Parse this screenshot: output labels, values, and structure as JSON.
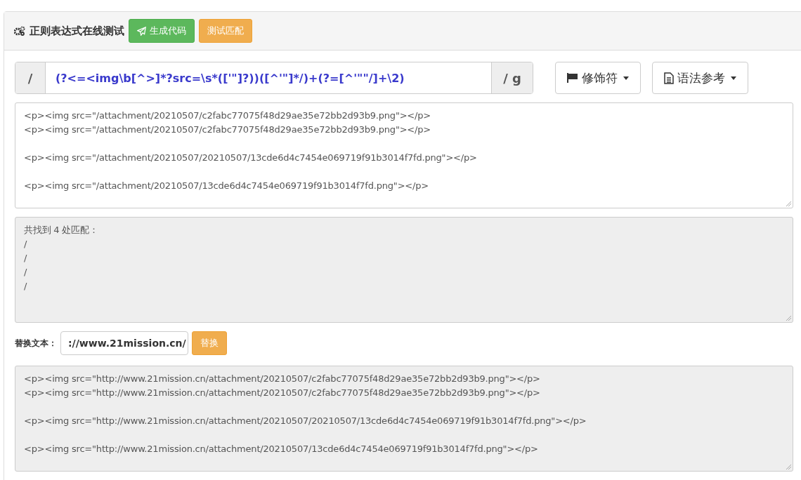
{
  "panel": {
    "title": "正则表达式在线测试",
    "buttons": [
      {
        "label": "生成代码",
        "kind": "success"
      },
      {
        "label": "测试匹配",
        "kind": "warning"
      }
    ]
  },
  "regex": {
    "prefix": "/",
    "value": "(?<=<img\\b[^>]*?src=\\s*(['\"]?))([^'\"]*/)+(?=[^'\"\"/]+\\2)",
    "suffix": "/ g"
  },
  "dropdowns": [
    {
      "label": "修饰符"
    },
    {
      "label": "语法参考"
    }
  ],
  "source": {
    "paragraphs": [
      [
        "<p><img src=\"/attachment/20210507/c2fabc77075f48d29ae35e72bb2d93b9.png\"></p>",
        "<p><img src=\"/attachment/20210507/c2fabc77075f48d29ae35e72bb2d93b9.png\"></p>"
      ],
      [
        "<p><img src=\"/attachment/20210507/20210507/13cde6d4c7454e069719f91b3014f7fd.png\"></p>"
      ],
      [
        "<p><img src=\"/attachment/20210507/13cde6d4c7454e069719f91b3014f7fd.png\"></p>"
      ]
    ]
  },
  "matches": {
    "summary": "共找到 4 处匹配：",
    "items": [
      "/",
      "/",
      "/",
      "/"
    ]
  },
  "replace": {
    "label": "替换文本：",
    "value": "://www.21mission.cn/",
    "button": "替换"
  },
  "result": {
    "paragraphs": [
      [
        "<p><img src=\"http://www.21mission.cn/attachment/20210507/c2fabc77075f48d29ae35e72bb2d93b9.png\"></p>",
        "<p><img src=\"http://www.21mission.cn/attachment/20210507/c2fabc77075f48d29ae35e72bb2d93b9.png\"></p>"
      ],
      [
        "<p><img src=\"http://www.21mission.cn/attachment/20210507/20210507/13cde6d4c7454e069719f91b3014f7fd.png\"></p>"
      ],
      [
        "<p><img src=\"http://www.21mission.cn/attachment/20210507/13cde6d4c7454e069719f91b3014f7fd.png\"></p>"
      ]
    ]
  }
}
